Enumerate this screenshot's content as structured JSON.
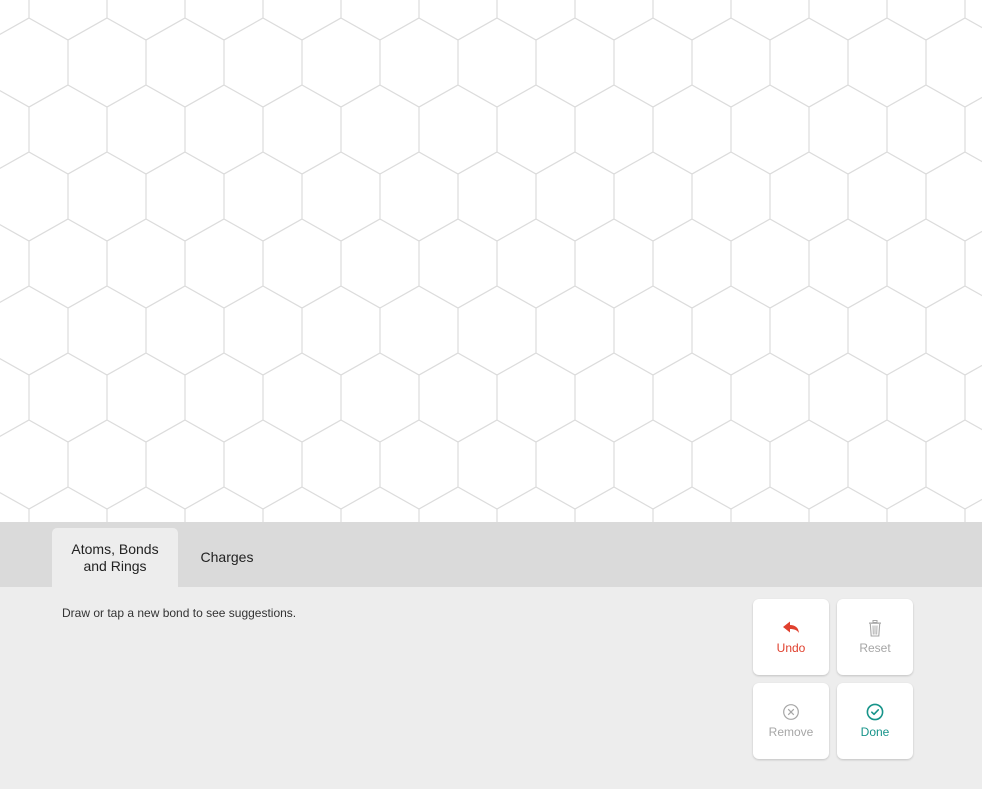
{
  "canvas": {
    "grid": "hexagonal",
    "grid_color": "#dcdcdc"
  },
  "tabs": [
    {
      "label": "Atoms, Bonds and Rings",
      "line1": "Atoms, Bonds",
      "line2": "and Rings",
      "active": true
    },
    {
      "label": "Charges",
      "active": false
    }
  ],
  "hint": "Draw or tap a new bond to see suggestions.",
  "buttons": {
    "undo": {
      "label": "Undo",
      "icon": "undo-arrow-icon",
      "color": "#e0402e",
      "enabled": true
    },
    "reset": {
      "label": "Reset",
      "icon": "trash-icon",
      "color": "#a6a6a6",
      "enabled": false
    },
    "remove": {
      "label": "Remove",
      "icon": "x-circle-icon",
      "color": "#a6a6a6",
      "enabled": false
    },
    "done": {
      "label": "Done",
      "icon": "check-circle-icon",
      "color": "#17948a",
      "enabled": true
    }
  }
}
